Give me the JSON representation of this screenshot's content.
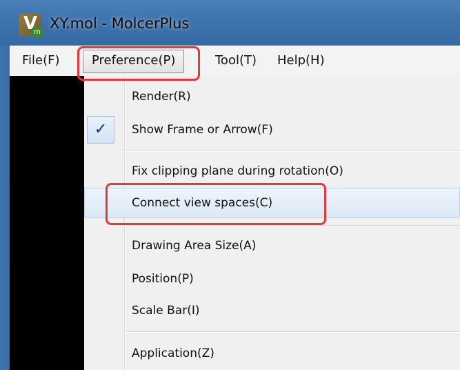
{
  "window": {
    "title": "XY.mol - MolcerPlus",
    "icon": "molcerplus-app-icon",
    "icon_glyph": "V",
    "icon_badge": "m"
  },
  "menubar": {
    "items": [
      {
        "label": "File(F)"
      },
      {
        "label": "Preference(P)",
        "state": "open"
      },
      {
        "label": "Tool(T)"
      },
      {
        "label": "Help(H)"
      }
    ]
  },
  "preference_menu": {
    "items": [
      {
        "label": "Render(R)"
      },
      {
        "label": "Show Frame or Arrow(F)",
        "checked": true,
        "check_glyph": "✓"
      },
      {
        "label": "Fix clipping plane during rotation(O)"
      },
      {
        "label": "Connect view spaces(C)",
        "hovered": true
      },
      {
        "label": "Drawing Area Size(A)"
      },
      {
        "label": "Position(P)"
      },
      {
        "label": "Scale Bar(I)"
      },
      {
        "label": "Application(Z)"
      }
    ]
  },
  "annotations": {
    "highlight_color": "#e23a3a",
    "highlighted": [
      "Preference(P)",
      "Connect view spaces(C)"
    ]
  },
  "colors": {
    "titlebar": "#3f74ae",
    "menubar_bg": "#f3f3f3",
    "dropdown_bg": "#f0f0f0",
    "canvas_bg": "#000000",
    "check": "#1a2a8a"
  }
}
